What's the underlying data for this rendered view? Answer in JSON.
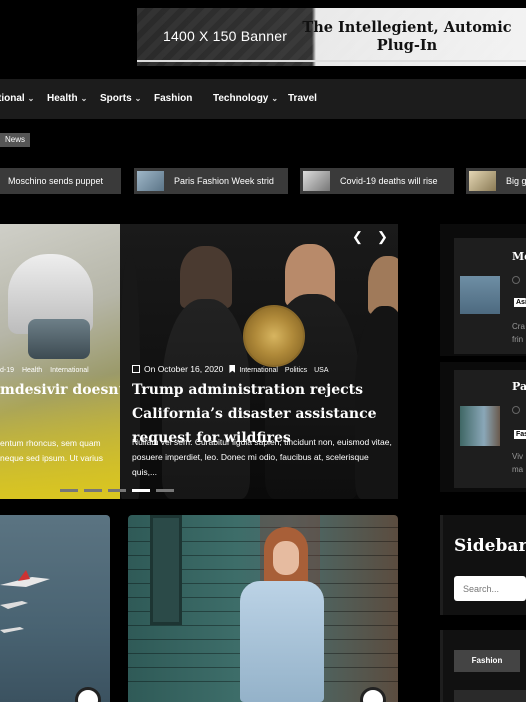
{
  "banner": {
    "size_text": "1400 X 150 Banner",
    "title": "The Intellegient, Automic Plug-In"
  },
  "nav": {
    "items": [
      {
        "label": "tional",
        "has_dropdown": true
      },
      {
        "label": "Health",
        "has_dropdown": true
      },
      {
        "label": "Sports",
        "has_dropdown": true
      },
      {
        "label": "Fashion",
        "has_dropdown": false
      },
      {
        "label": "Technology",
        "has_dropdown": true
      },
      {
        "label": "Travel",
        "has_dropdown": false
      }
    ]
  },
  "news_tag": "News",
  "ticker": [
    {
      "text": "Moschino sends puppet"
    },
    {
      "text": "Paris Fashion Week strid"
    },
    {
      "text": "Covid-19 deaths will rise"
    },
    {
      "text": "Big g"
    }
  ],
  "slider": {
    "left": {
      "categories": [
        "d-19",
        "Health",
        "International"
      ],
      "title": "mdesivir doesn’t",
      "excerpt": "entum rhoncus, sem quam neque sed ipsum. Ut varius"
    },
    "main": {
      "date": "On October 16, 2020",
      "categories": [
        "International",
        "Politics",
        "USA"
      ],
      "title": "Trump administration rejects California’s disaster assistance request for wildfires",
      "excerpt": "Nullam vel sem. Curabitur ligula sapien, tincidunt non, euismod vitae, posuere imperdiet, leo. Donec mi odio, faucibus at, scelerisque quis,..."
    },
    "prev_icon": "chevron-left-icon",
    "next_icon": "chevron-right-icon",
    "dots": 5,
    "active_dot": 4
  },
  "right_cards": [
    {
      "title": "Mo",
      "tag": "Asi",
      "text": [
        "Cra",
        "frin"
      ]
    },
    {
      "title": "Par",
      "tag": "Fas",
      "text": [
        "Viv",
        "ma"
      ]
    }
  ],
  "sidebar": {
    "widget_title": "Sidebar W",
    "search_placeholder": "Search...",
    "fashion_label": "Fashion"
  }
}
